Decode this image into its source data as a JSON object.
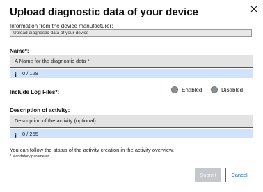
{
  "dialog": {
    "title": "Upload diagnostic data of your device",
    "close_icon": "close-icon"
  },
  "manufacturer": {
    "label": "Information from the device manufacturer:",
    "value": "Upload diagnostic data of your device"
  },
  "name": {
    "label": "Name*:",
    "placeholder": "A Name for the diagnostic data *",
    "counter": "0 / 128"
  },
  "log_files": {
    "label": "Include Log Files*:",
    "options": [
      {
        "label": "Enabled"
      },
      {
        "label": "Disabled"
      }
    ]
  },
  "description": {
    "label": "Description of activity:",
    "placeholder": "Description of the activity (optional)",
    "counter": "0 / 255"
  },
  "footer": {
    "info_text": "You can follow the status of the activity creation in the activity overview.",
    "mandatory_note": "* Mandatory parameter"
  },
  "buttons": {
    "submit": "Submit",
    "cancel": "Cancel"
  },
  "colors": {
    "primary": "#1f6fc3",
    "counter_bg": "#cfe3fb",
    "field_bg": "#e3e3e3",
    "disabled_button": "#c4c7cc"
  }
}
